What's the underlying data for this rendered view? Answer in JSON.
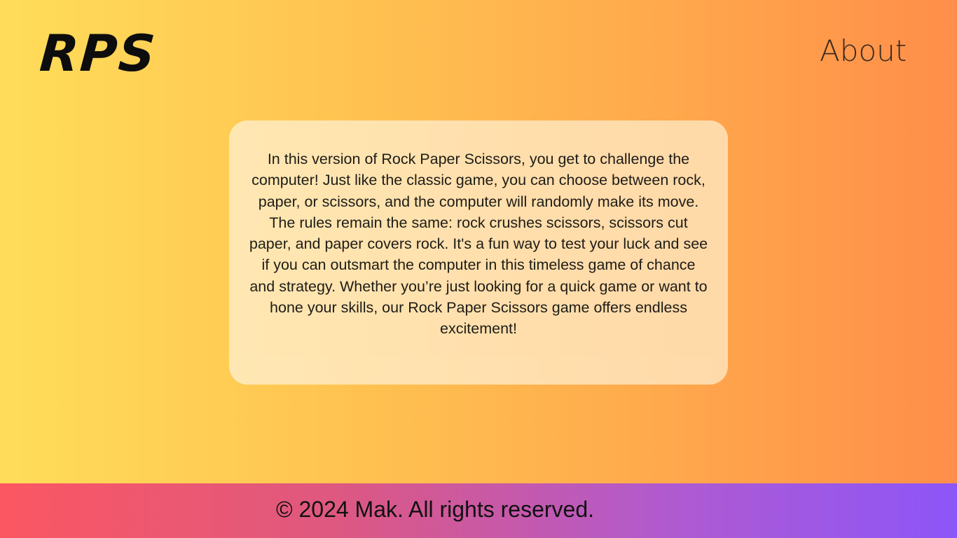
{
  "header": {
    "logo": "RPS",
    "nav_about": "About"
  },
  "main": {
    "about_text": "In this version of Rock Paper Scissors, you get to challenge the computer! Just like the classic game, you can choose between rock, paper, or scissors, and the computer will randomly make its move. The rules remain the same: rock crushes scissors, scissors cut paper, and paper covers rock. It's a fun way to test your luck and see if you can outsmart the computer in this timeless game of chance and strategy. Whether you’re just looking for a quick game or want to hone your skills, our Rock Paper Scissors game offers endless excitement!"
  },
  "footer": {
    "copyright": "© 2024 Mak. All rights reserved."
  },
  "colors": {
    "background_start": "#ffdd5a",
    "background_end": "#ff8e4a",
    "card": "#ffe2b3",
    "footer_start": "#fb5762",
    "footer_end": "#8c56f8"
  }
}
